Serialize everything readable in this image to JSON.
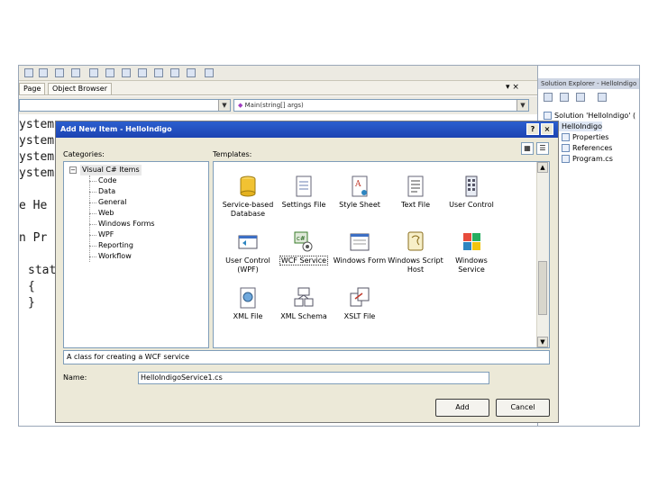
{
  "ide": {
    "tabs": [
      "Page",
      "Object Browser"
    ],
    "tab_close": "▾ ×",
    "nav_combo_left": "",
    "nav_combo_right": "Main(string[] args)",
    "code_lines": [
      "ystem",
      "ystem",
      "ystem",
      "ystem",
      "e He",
      "n Pr",
      "stat",
      "{",
      "}"
    ],
    "solution_explorer": {
      "title": "Solution Explorer - HelloIndigo",
      "items": [
        "Solution 'HelloIndigo' (",
        "HelloIndigo",
        "Properties",
        "References",
        "Program.cs"
      ]
    }
  },
  "dialog": {
    "title": "Add New Item - HelloIndigo",
    "help_button": "?",
    "close_button": "×",
    "categories_label": "Categories:",
    "templates_label": "Templates:",
    "categories": {
      "root": "Visual C# Items",
      "children": [
        "Code",
        "Data",
        "General",
        "Web",
        "Windows Forms",
        "WPF",
        "Reporting",
        "Workflow"
      ]
    },
    "templates": [
      {
        "label": "Service-based Database",
        "icon": "database-icon"
      },
      {
        "label": "Settings File",
        "icon": "settings-file-icon"
      },
      {
        "label": "Style Sheet",
        "icon": "style-sheet-icon"
      },
      {
        "label": "Text File",
        "icon": "text-file-icon"
      },
      {
        "label": "User Control",
        "icon": "user-control-icon"
      },
      {
        "label": "User Control (WPF)",
        "icon": "wpf-user-control-icon"
      },
      {
        "label": "WCF Service",
        "icon": "wcf-service-icon"
      },
      {
        "label": "Windows Form",
        "icon": "windows-form-icon"
      },
      {
        "label": "Windows Script Host",
        "icon": "script-host-icon"
      },
      {
        "label": "Windows Service",
        "icon": "windows-service-icon"
      },
      {
        "label": "XML File",
        "icon": "xml-file-icon"
      },
      {
        "label": "XML Schema",
        "icon": "xml-schema-icon"
      },
      {
        "label": "XSLT File",
        "icon": "xslt-file-icon"
      }
    ],
    "selected_template": "WCF Service",
    "description": "A class for creating a WCF service",
    "name_label": "Name:",
    "name_value": "HelloIndigoService1.cs",
    "add_button": "Add",
    "cancel_button": "Cancel",
    "colors": {
      "title_bar": "#1c43b2",
      "dialog_bg": "#ece9d8",
      "field_border": "#7f9db9"
    }
  }
}
